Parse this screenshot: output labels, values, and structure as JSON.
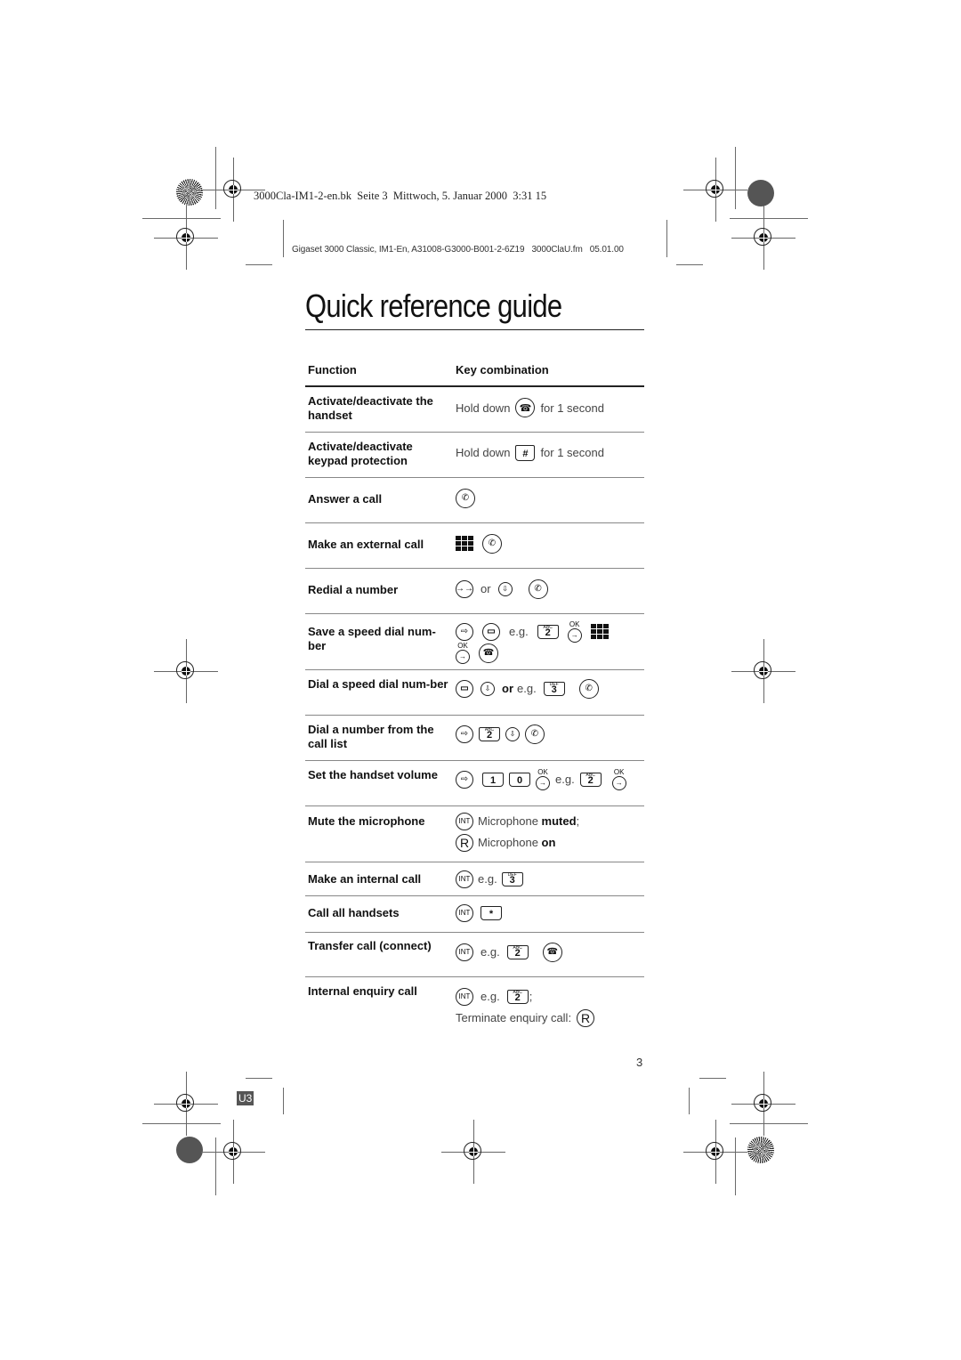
{
  "print_header": {
    "line1": "3000Cla-IM1-2-en.bk  Seite 3  Mittwoch, 5. Januar 2000  3:31 15",
    "line2": "Gigaset 3000 Classic, IM1-En, A31008-G3000-B001-2-6Z19   3000ClaU.fm   05.01.00"
  },
  "title": "Quick reference guide",
  "table": {
    "headers": {
      "function": "Function",
      "keys": "Key combination"
    },
    "rows": [
      {
        "function": "Activate/deactivate the handset",
        "hold": "Hold down",
        "suffix": "for 1 second",
        "icon": "end-call-key"
      },
      {
        "function": "Activate/deactivate keypad protection",
        "hold": "Hold down",
        "suffix": "for 1 second",
        "icon": "hash-key"
      },
      {
        "function": "Answer a call",
        "icon": "talk-key"
      },
      {
        "function": "Make an external call",
        "icons": [
          "keypad",
          "talk-key"
        ]
      },
      {
        "function": "Redial a number",
        "or": "or",
        "icons": [
          "redial-key",
          "phonebook-down-key",
          "talk-key"
        ]
      },
      {
        "function": "Save a speed dial num-ber",
        "eg": "e.g.",
        "ok": "OK",
        "key": "2",
        "key_sup": "ABC"
      },
      {
        "function": "Dial a speed dial num-ber",
        "or_eg_bold": "or",
        "eg": "e.g.",
        "key": "3",
        "key_sup": "DEF"
      },
      {
        "function": "Dial a number from the call list",
        "key": "2",
        "key_sup": "ABC"
      },
      {
        "function": "Set the handset volume",
        "keys": [
          "1",
          "0"
        ],
        "ok": "OK",
        "eg": "e.g.",
        "key": "2",
        "key_sup": "ABC"
      },
      {
        "function": "Mute the microphone",
        "int_label": "INT",
        "r_label": "R",
        "line1_text": "Microphone ",
        "line1_bold": "muted",
        "line1_tail": ";",
        "line2_text": "Microphone ",
        "line2_bold": "on"
      },
      {
        "function": "Make an internal call",
        "int_label": "INT",
        "eg": "e.g.",
        "key": "3",
        "key_sup": "DEF"
      },
      {
        "function": "Call all handsets",
        "int_label": "INT",
        "key": "*"
      },
      {
        "function": "Transfer call (connect)",
        "int_label": "INT",
        "eg": "e.g.",
        "key": "2",
        "key_sup": "ABC"
      },
      {
        "function": "Internal enquiry call",
        "int_label": "INT",
        "eg": "e.g.",
        "key": "2",
        "key_sup": "ABC",
        "tail": ";",
        "terminate": "Terminate enquiry call:",
        "r_label": "R"
      }
    ]
  },
  "page_number": "3",
  "page_tag": "U3"
}
